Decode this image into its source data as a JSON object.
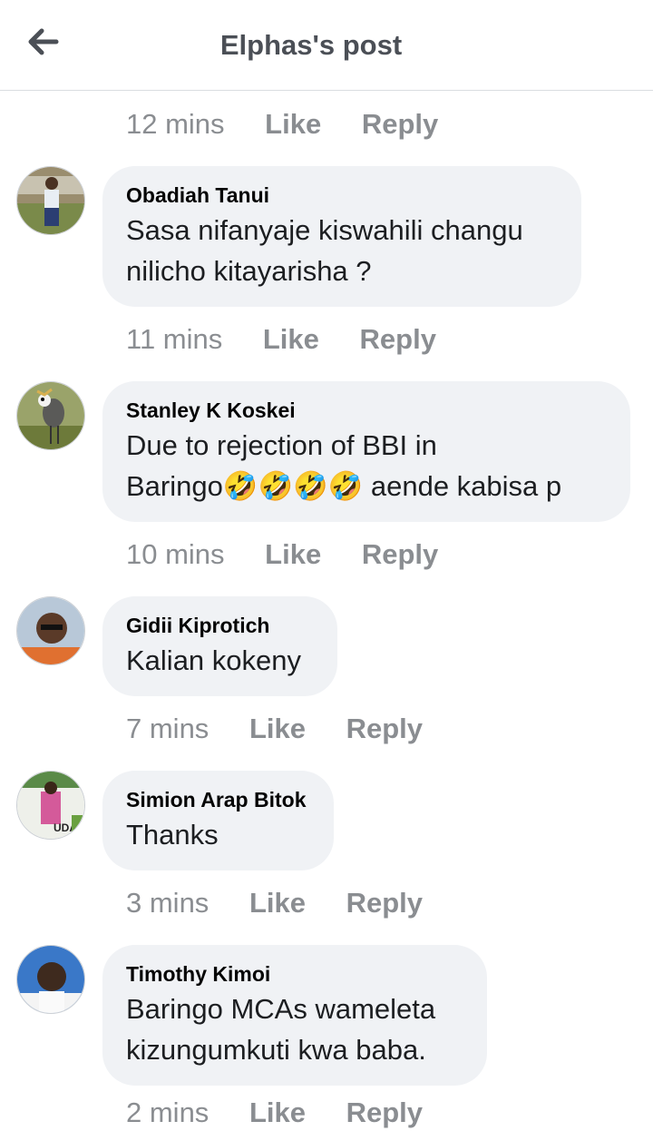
{
  "header": {
    "title": "Elphas's post",
    "back_icon": "arrow-left-icon"
  },
  "actions": {
    "like": "Like",
    "reply": "Reply"
  },
  "top_partial": {
    "time": "12 mins"
  },
  "comments": [
    {
      "author": "Obadiah Tanui",
      "text": "Sasa nifanyaje kiswahili changu\nnilicho kitayarisha ?",
      "time": "11 mins"
    },
    {
      "author": "Stanley K Koskei",
      "text": "Due to rejection of BBI in\nBaringo🤣🤣🤣🤣 aende kabisa p",
      "time": "10 mins"
    },
    {
      "author": "Gidii Kiprotich",
      "text": "Kalian kokeny",
      "time": "7 mins"
    },
    {
      "author": "Simion Arap Bitok",
      "text": "Thanks",
      "time": "3 mins",
      "avatar_text": "UDA"
    },
    {
      "author": "Timothy Kimoi",
      "text": "Baringo MCAs wameleta\nkizungumkuti kwa baba.",
      "time": "2 mins"
    }
  ]
}
